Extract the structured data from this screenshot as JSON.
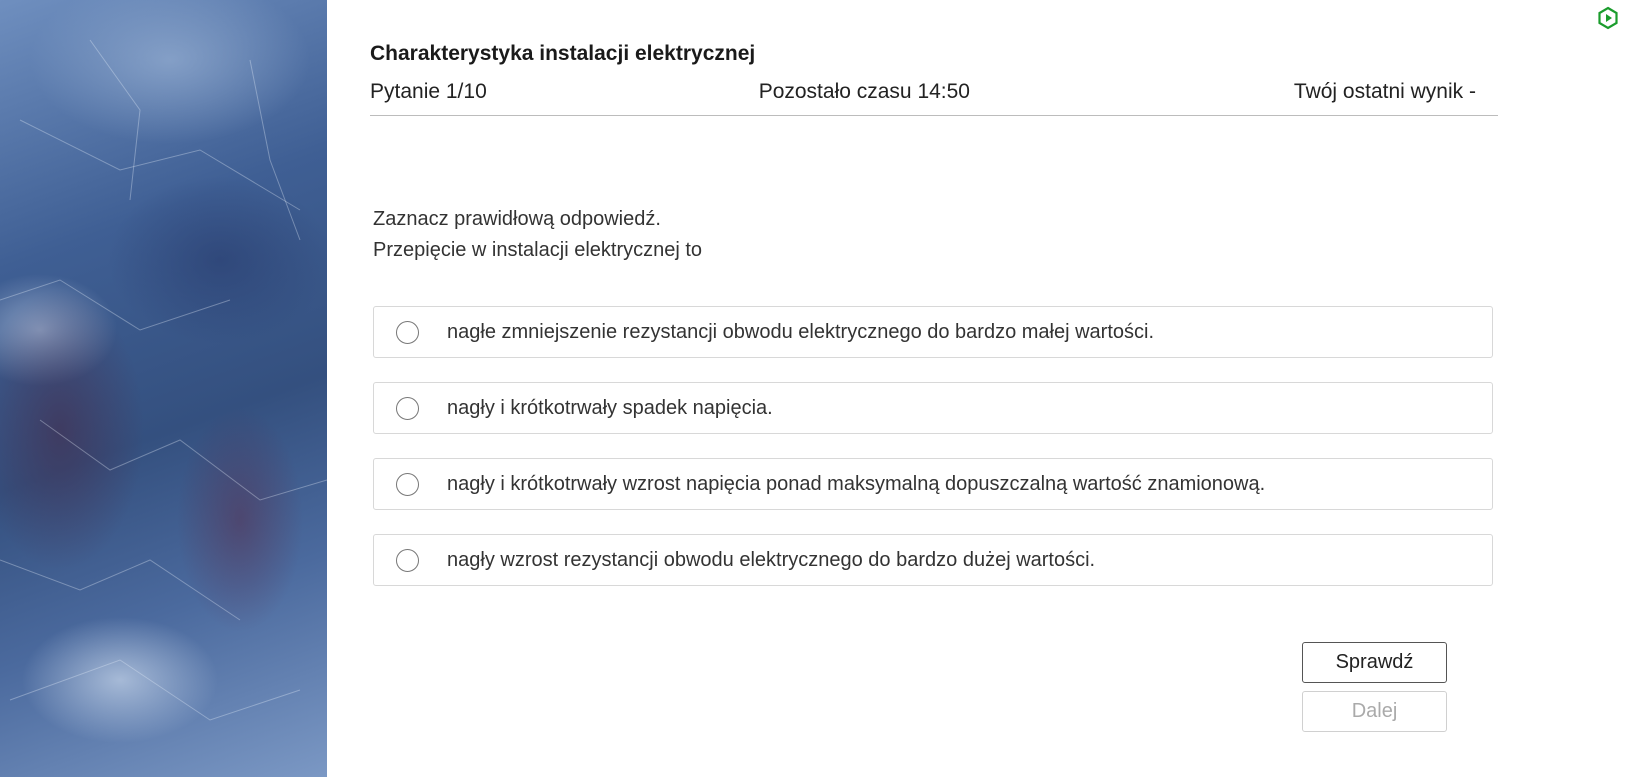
{
  "side_panel": {
    "image": "blue-marble-texture"
  },
  "corner": {
    "icon": "hexagon-play-icon",
    "color": "#1a9c2c"
  },
  "quiz": {
    "title": "Charakterystyka instalacji elektrycznej",
    "question_counter": "Pytanie 1/10",
    "time_remaining": "Pozostało czasu 14:50",
    "last_score": "Twój ostatni wynik -"
  },
  "question": {
    "instruction": "Zaznacz prawidłową odpowiedź.",
    "text": "Przepięcie w instalacji elektrycznej to"
  },
  "answers": [
    {
      "label": "nagłe zmniejszenie rezystancji obwodu elektrycznego do bardzo małej wartości.",
      "selected": false
    },
    {
      "label": "nagły i krótkotrwały spadek napięcia.",
      "selected": false
    },
    {
      "label": "nagły i krótkotrwały wzrost napięcia ponad maksymalną dopuszczalną wartość znamionową.",
      "selected": false
    },
    {
      "label": "nagły wzrost rezystancji obwodu elektrycznego do bardzo dużej wartości.",
      "selected": false
    }
  ],
  "actions": {
    "check_label": "Sprawdź",
    "next_label": "Dalej",
    "next_disabled": true
  }
}
